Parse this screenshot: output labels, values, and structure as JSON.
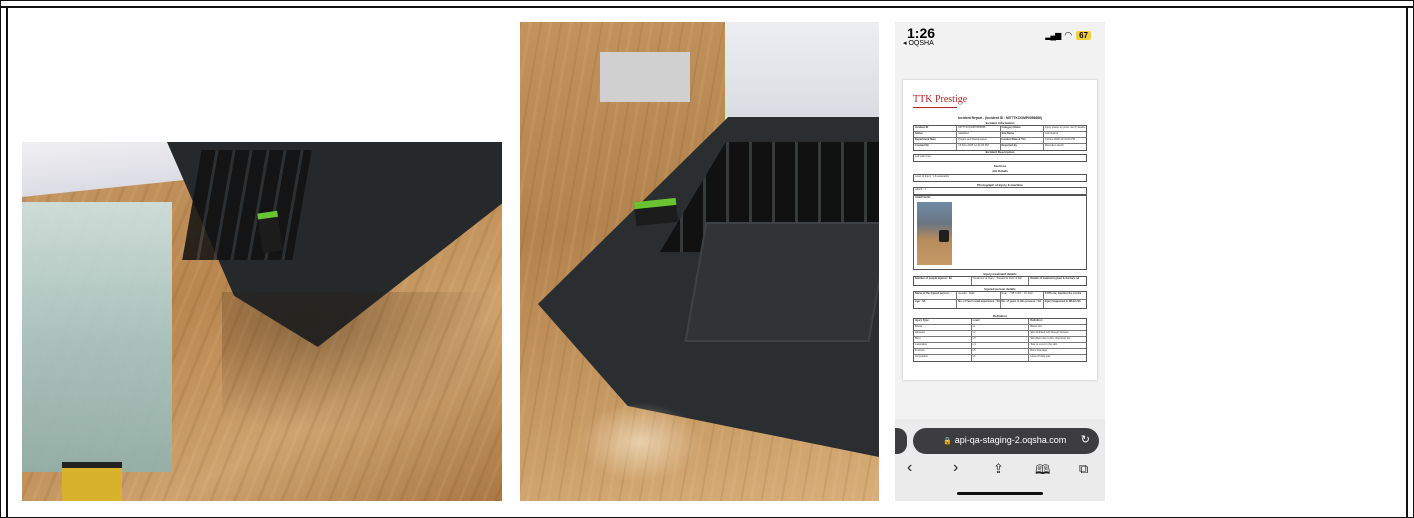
{
  "phone": {
    "time": "1:26",
    "back_app": "◂ OQSHA",
    "battery": "67",
    "signal_icon": "signal-bars-icon",
    "wifi_icon": "wifi-icon"
  },
  "report": {
    "brand": "TTK Prestige",
    "title": "Incident Report - (Incident ID : MIT7TKOOMP0056686)",
    "sections": {
      "info": "Incident Information",
      "description": "Incident Description",
      "sections": "Sections",
      "job": "Job Details",
      "photo": "Photograph of injury & machine",
      "injury": "Injury treatment details",
      "injured": "Injured person details",
      "definition": "Definition"
    },
    "info_rows": [
      [
        "Incident ID",
        "MIT7TKOOMP0056686",
        "Category Name",
        "Injury (caste an prost. iam?) deaths"
      ],
      [
        "Status",
        "Validated",
        "Site Name",
        "Coimbatore"
      ],
      [
        "Department Nam",
        "Project and Maintenance",
        "Incident Date & Tim",
        "13-Nov-2025 12:41:00 PM"
      ],
      [
        "Created On",
        "13-Nov-2025 12:41:06 PM",
        "Reported By",
        "Mounika Lokesh"
      ]
    ],
    "description_text": "Left palm fore",
    "job_text": "Level of Injury : L4-Laceration",
    "attach_label": "Attach : 1",
    "attachments_label": "Attachments",
    "injury_rows": [
      [
        "Number of people injured : 0A",
        "Treatment of Injury : Treated at OHC & Ref",
        "Details of treatment given & doctor's ad"
      ]
    ],
    "injured_rows": [
      [
        "Name of the injured person : -",
        "Gender : Male",
        "Role : - OB / OFF : On Roll",
        "If Off role, mention the contra"
      ],
      [
        "Age : 0A",
        "No. of Year's total experience : 0A",
        "No. of years in this process : 0A",
        "Injury Happened in Which Sh"
      ]
    ],
    "definition_rows": [
      [
        "Injury Type",
        "Level",
        "Definition"
      ],
      [
        "Bruise",
        "L1",
        "Blood clot"
      ],
      [
        "Abrasion",
        "L2",
        "Skin Rubbed with Rough Surface"
      ],
      [
        "Burn",
        "L3",
        "Skin Burn due to fire, chemical, etc"
      ],
      [
        "Laceration",
        "L4",
        "Tear or a cut in the skin"
      ],
      [
        "Fracture",
        "L5",
        "Bone Damage"
      ],
      [
        "Amputation",
        "L6",
        "Loss of body part"
      ]
    ]
  },
  "browser": {
    "url": "api-qa-staging-2.oqsha.com",
    "lock_icon": "lock-icon",
    "reload_icon": "reload-icon",
    "back": "‹",
    "forward": "›",
    "share": "⇪",
    "bookmarks": "🕮",
    "tabs": "⧉"
  }
}
